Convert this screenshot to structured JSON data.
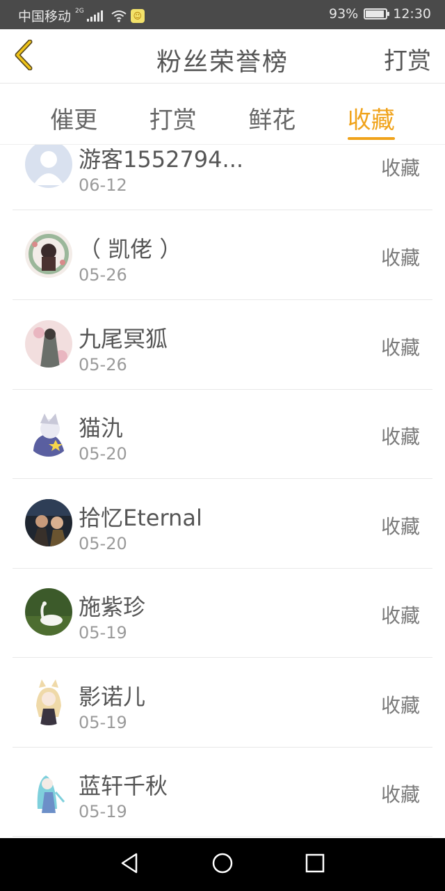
{
  "status_bar": {
    "carrier": "中国移动",
    "network": "2G",
    "battery_percent": "93%",
    "battery_level": 0.93,
    "time": "12:30"
  },
  "header": {
    "title": "粉丝荣誉榜",
    "action": "打赏",
    "back_icon": "chevron-left-icon"
  },
  "tabs": [
    {
      "label": "催更",
      "active": false
    },
    {
      "label": "打赏",
      "active": false
    },
    {
      "label": "鲜花",
      "active": false
    },
    {
      "label": "收藏",
      "active": true
    }
  ],
  "list": [
    {
      "name": "游客1552794...",
      "date": "06-12",
      "action": "收藏"
    },
    {
      "name": "（ 凯佬 ）",
      "date": "05-26",
      "action": "收藏"
    },
    {
      "name": "九尾冥狐",
      "date": "05-26",
      "action": "收藏"
    },
    {
      "name": "猫氿",
      "date": "05-20",
      "action": "收藏"
    },
    {
      "name": "拾忆Eternal",
      "date": "05-20",
      "action": "收藏"
    },
    {
      "name": "施紫珍",
      "date": "05-19",
      "action": "收藏"
    },
    {
      "name": "影诺儿",
      "date": "05-19",
      "action": "收藏"
    },
    {
      "name": "蓝轩千秋",
      "date": "05-19",
      "action": "收藏"
    }
  ],
  "colors": {
    "accent": "#f0a31b",
    "status_bar_bg": "#4a4a4a",
    "nav_bar_bg": "#000000"
  }
}
